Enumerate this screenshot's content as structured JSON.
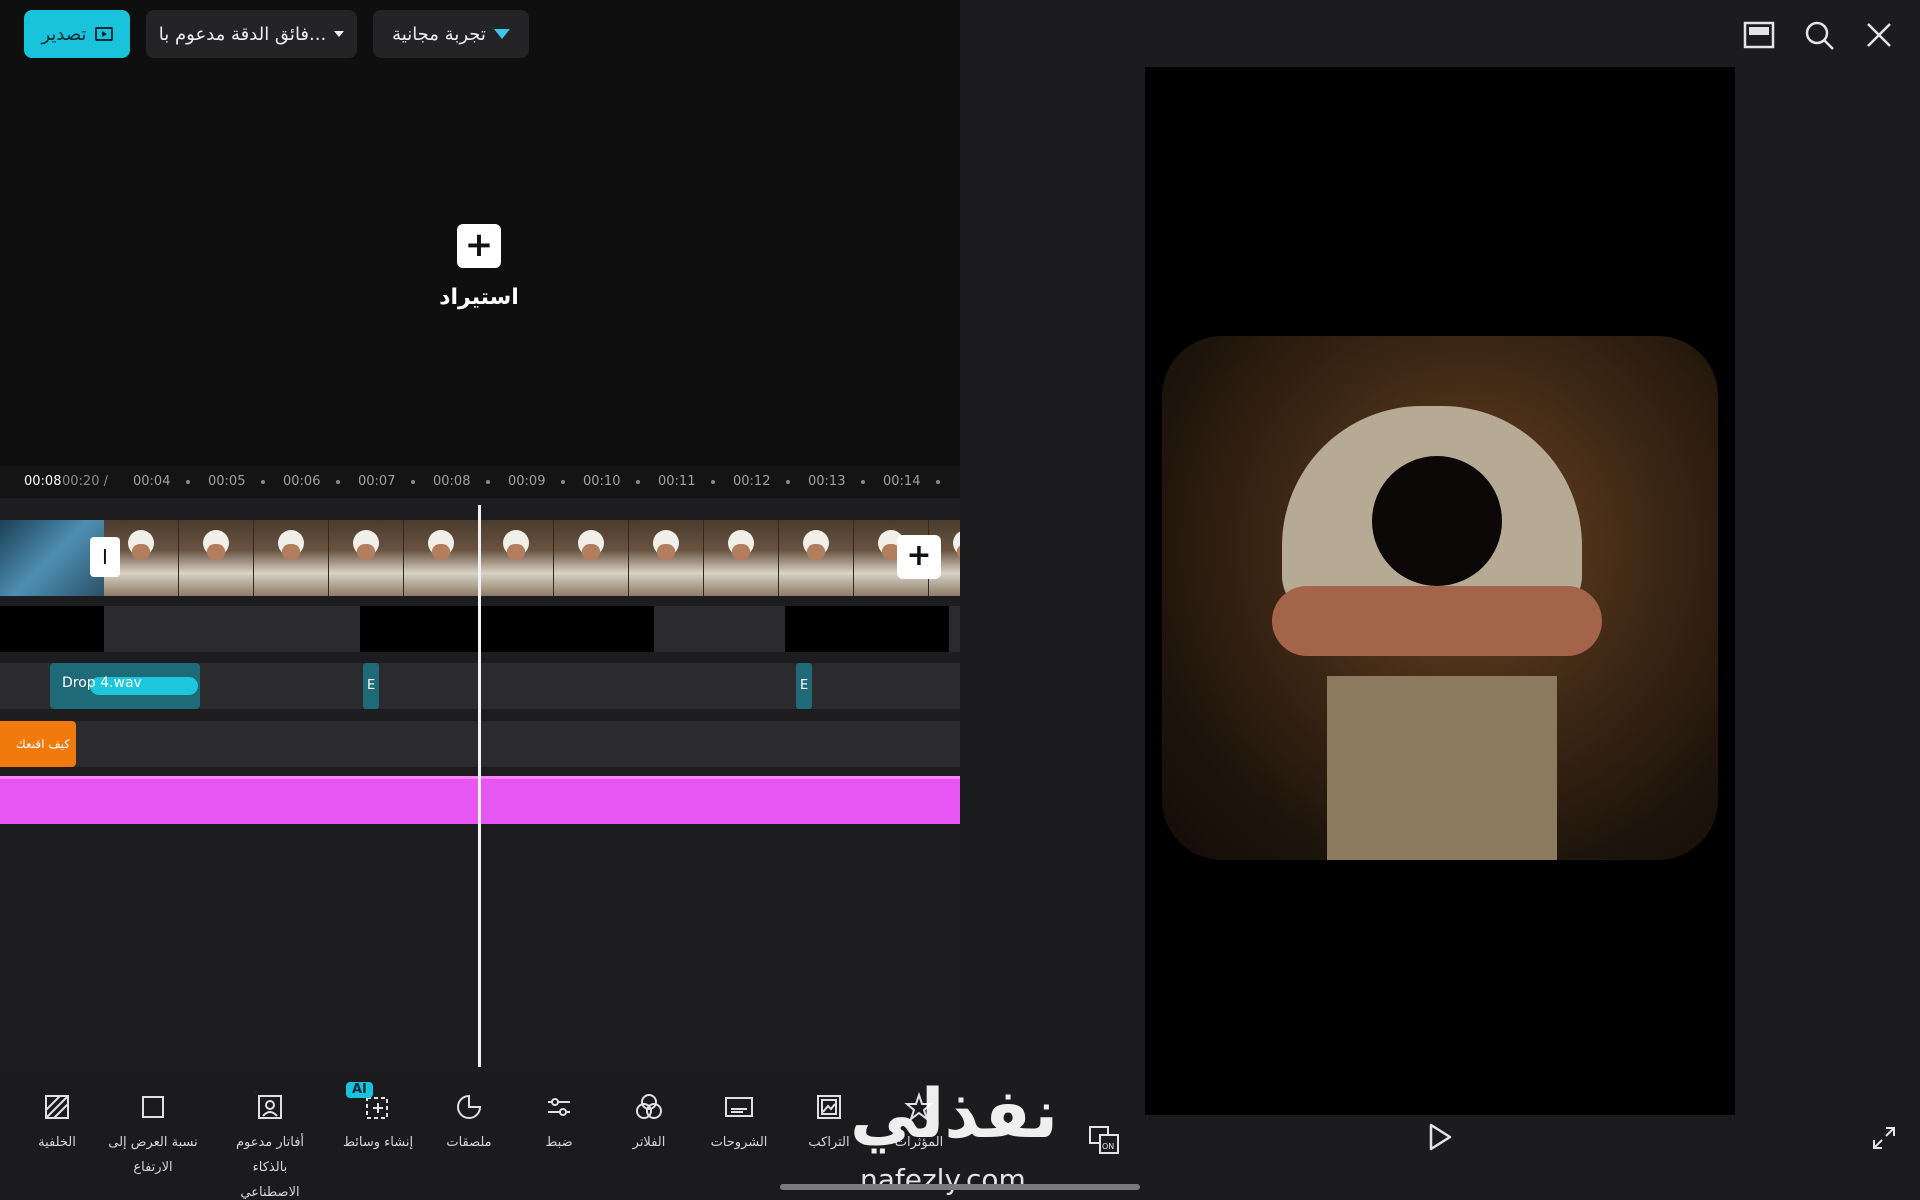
{
  "header": {
    "export_label": "تصدير",
    "resolution_label": "فائق الدقة مدعوم با...",
    "trial_label": "تجربة مجانية"
  },
  "import": {
    "label": "استيراد"
  },
  "timeline": {
    "current_time": "00:08",
    "total_time": "00:20 /",
    "ticks": [
      "00:04",
      "00:05",
      "00:06",
      "00:07",
      "00:08",
      "00:09",
      "00:10",
      "00:11",
      "00:12",
      "00:13",
      "00:14"
    ],
    "audio_clip": "Drop 4.wav",
    "audio_mini_1": "E",
    "audio_mini_2": "E",
    "text_clip": "كيف اقنعك"
  },
  "toolbar": {
    "items": [
      {
        "label": "الخلفية",
        "icon": "background-icon"
      },
      {
        "label": "نسبة العرض إلى الارتفاع",
        "icon": "aspect-ratio-icon"
      },
      {
        "label": "أفاتار مدعوم بالذكاء الاصطناعي",
        "icon": "ai-avatar-icon"
      },
      {
        "label": "إنشاء وسائط",
        "icon": "create-media-icon"
      },
      {
        "label": "ملصقات",
        "icon": "stickers-icon"
      },
      {
        "label": "ضبط",
        "icon": "adjust-icon"
      },
      {
        "label": "الفلاتر",
        "icon": "filters-icon"
      },
      {
        "label": "الشروحات",
        "icon": "captions-icon"
      },
      {
        "label": "التراكب",
        "icon": "overlay-icon"
      },
      {
        "label": "المؤثرات",
        "icon": "effects-icon"
      }
    ],
    "ai_badge": "AI"
  },
  "watermark": {
    "arabic": "نفذلي",
    "english": "nafezly.com"
  },
  "colors": {
    "accent": "#18c3db",
    "effect_track": "#e755f2",
    "text_clip": "#f27a0d"
  }
}
